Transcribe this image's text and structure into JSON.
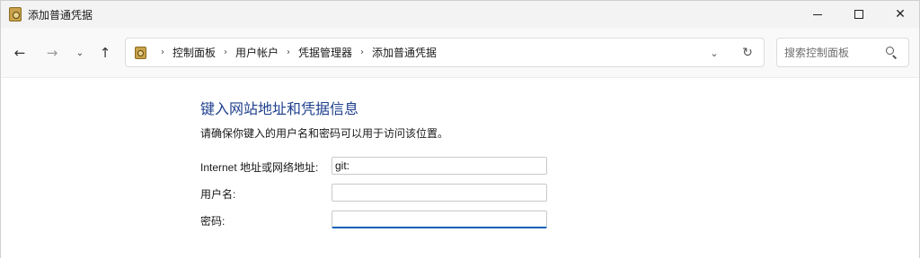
{
  "window": {
    "title": "添加普通凭据"
  },
  "nav": {
    "back_icon": "arrow-left-icon",
    "forward_icon": "arrow-right-icon",
    "recent_icon": "chevron-down-icon",
    "up_icon": "arrow-up-icon"
  },
  "address": {
    "crumbs": [
      "控制面板",
      "用户帐户",
      "凭据管理器",
      "添加普通凭据"
    ]
  },
  "search": {
    "placeholder": "搜索控制面板"
  },
  "form": {
    "heading": "键入网站地址和凭据信息",
    "description": "请确保你键入的用户名和密码可以用于访问该位置。",
    "address_label": "Internet 地址或网络地址:",
    "address_value": "git:",
    "username_label": "用户名:",
    "username_value": "",
    "password_label": "密码:",
    "password_value": ""
  },
  "colors": {
    "heading": "#1e3f8c",
    "focus": "#0a5fb4"
  }
}
